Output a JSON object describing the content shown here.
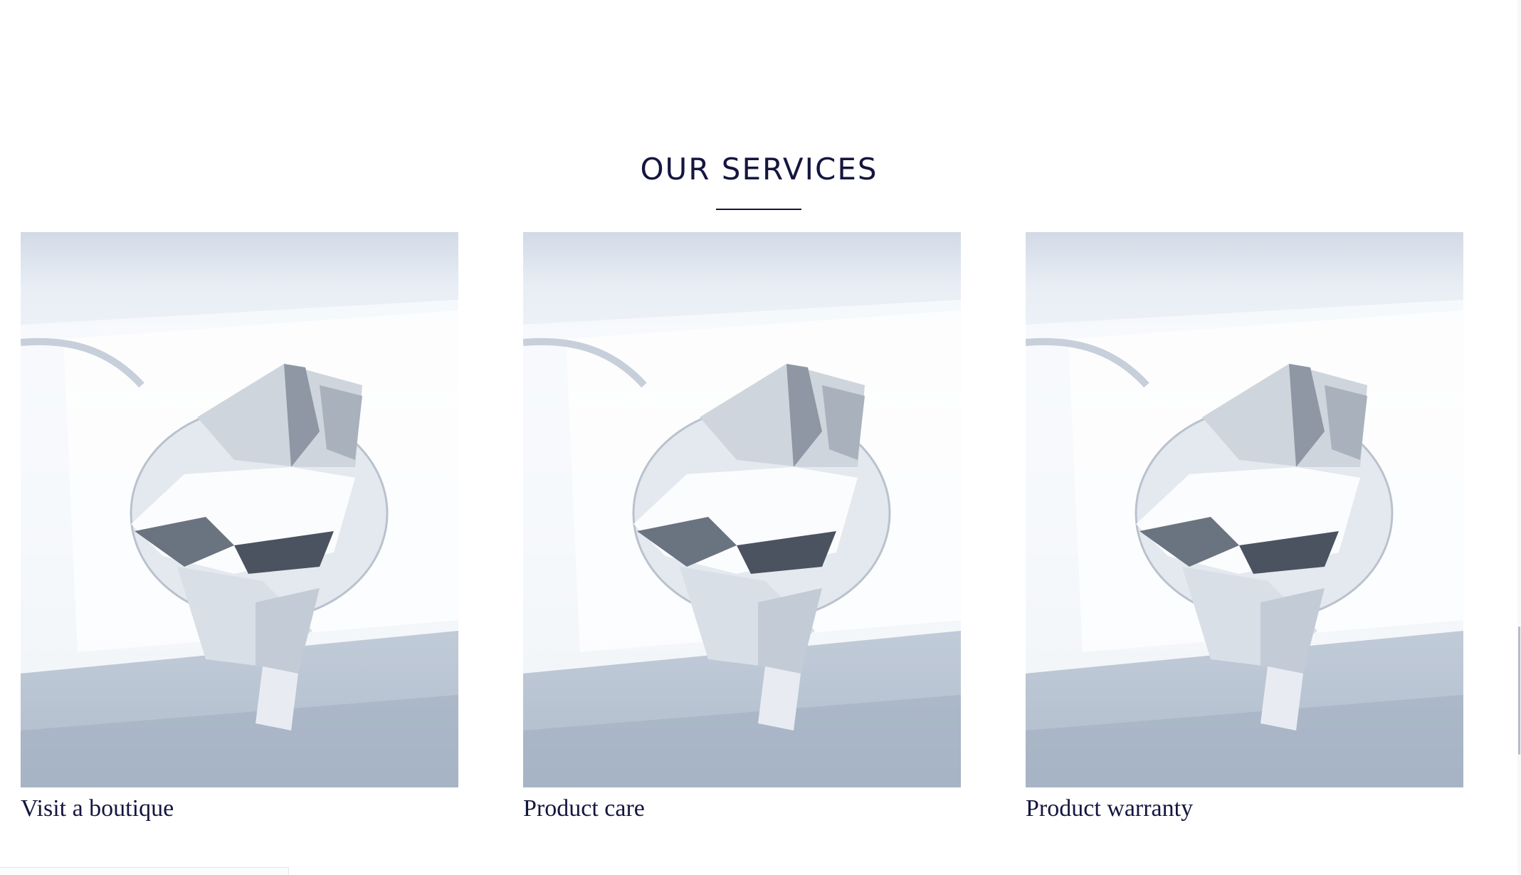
{
  "section": {
    "title": "OUR SERVICES"
  },
  "services": [
    {
      "label": "Visit a boutique",
      "image": "diamond-photo"
    },
    {
      "label": "Product care",
      "image": "diamond-photo"
    },
    {
      "label": "Product warranty",
      "image": "diamond-photo"
    }
  ],
  "colors": {
    "title": "#14163f",
    "label": "#14163f",
    "background": "#ffffff"
  }
}
